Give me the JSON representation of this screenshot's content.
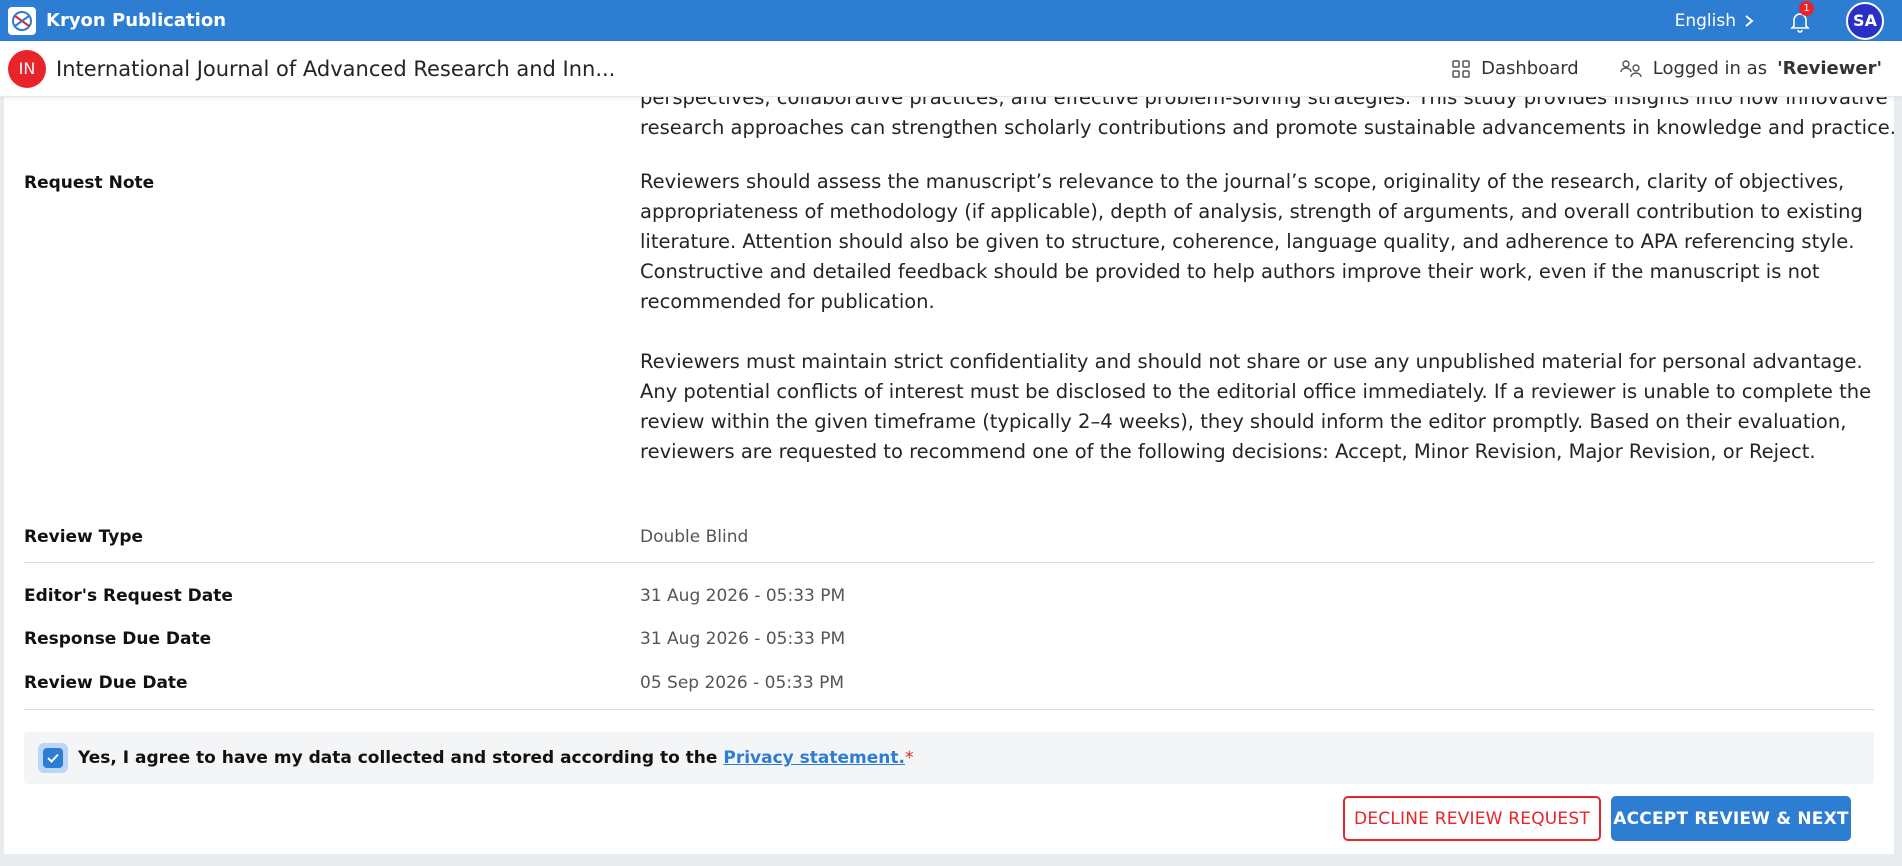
{
  "topbar": {
    "brand": "Kryon Publication",
    "language": "English",
    "notification_count": "1",
    "avatar_initials": "SA"
  },
  "subheader": {
    "journal_initials": "IN",
    "journal_title": "International Journal of Advanced Research and Inn...",
    "dashboard": "Dashboard",
    "logged_in_prefix": "Logged in as",
    "logged_in_role": "'Reviewer'"
  },
  "abstract_tail": {
    "line1": "perspectives, collaborative practices, and effective problem-solving strategies. This study provides insights into how innovative",
    "line2": "research approaches can strengthen scholarly contributions and promote sustainable advancements in knowledge and practice."
  },
  "request_note": {
    "label": "Request Note",
    "para1": "Reviewers should assess the manuscript’s relevance to the journal’s scope, originality of the research, clarity of objectives, appropriateness of methodology (if applicable), depth of analysis, strength of arguments, and overall contribution to existing literature. Attention should also be given to structure, coherence, language quality, and adherence to APA referencing style. Constructive and detailed feedback should be provided to help authors improve their work, even if the manuscript is not recommended for publication.",
    "para2": "Reviewers must maintain strict confidentiality and should not share or use any unpublished material for personal advantage. Any potential conflicts of interest must be disclosed to the editorial office immediately. If a reviewer is unable to complete the review within the given timeframe (typically 2–4 weeks), they should inform the editor promptly. Based on their evaluation, reviewers are requested to recommend one of the following decisions: Accept, Minor Revision, Major Revision, or Reject."
  },
  "details": {
    "review_type_label": "Review Type",
    "review_type_value": "Double Blind",
    "editor_request_label": "Editor's Request Date",
    "editor_request_value": "31 Aug 2026 - 05:33 PM",
    "response_due_label": "Response Due Date",
    "response_due_value": "31 Aug 2026 - 05:33 PM",
    "review_due_label": "Review Due Date",
    "review_due_value": "05 Sep 2026 - 05:33 PM"
  },
  "consent": {
    "text": "Yes, I agree to have my data collected and stored according to the",
    "link": "Privacy statement.",
    "required_mark": "*",
    "checked": true
  },
  "actions": {
    "decline": "DECLINE REVIEW REQUEST",
    "accept": "ACCEPT REVIEW & NEXT"
  },
  "colors": {
    "primary": "#2d7dd2",
    "danger": "#e8232a"
  }
}
